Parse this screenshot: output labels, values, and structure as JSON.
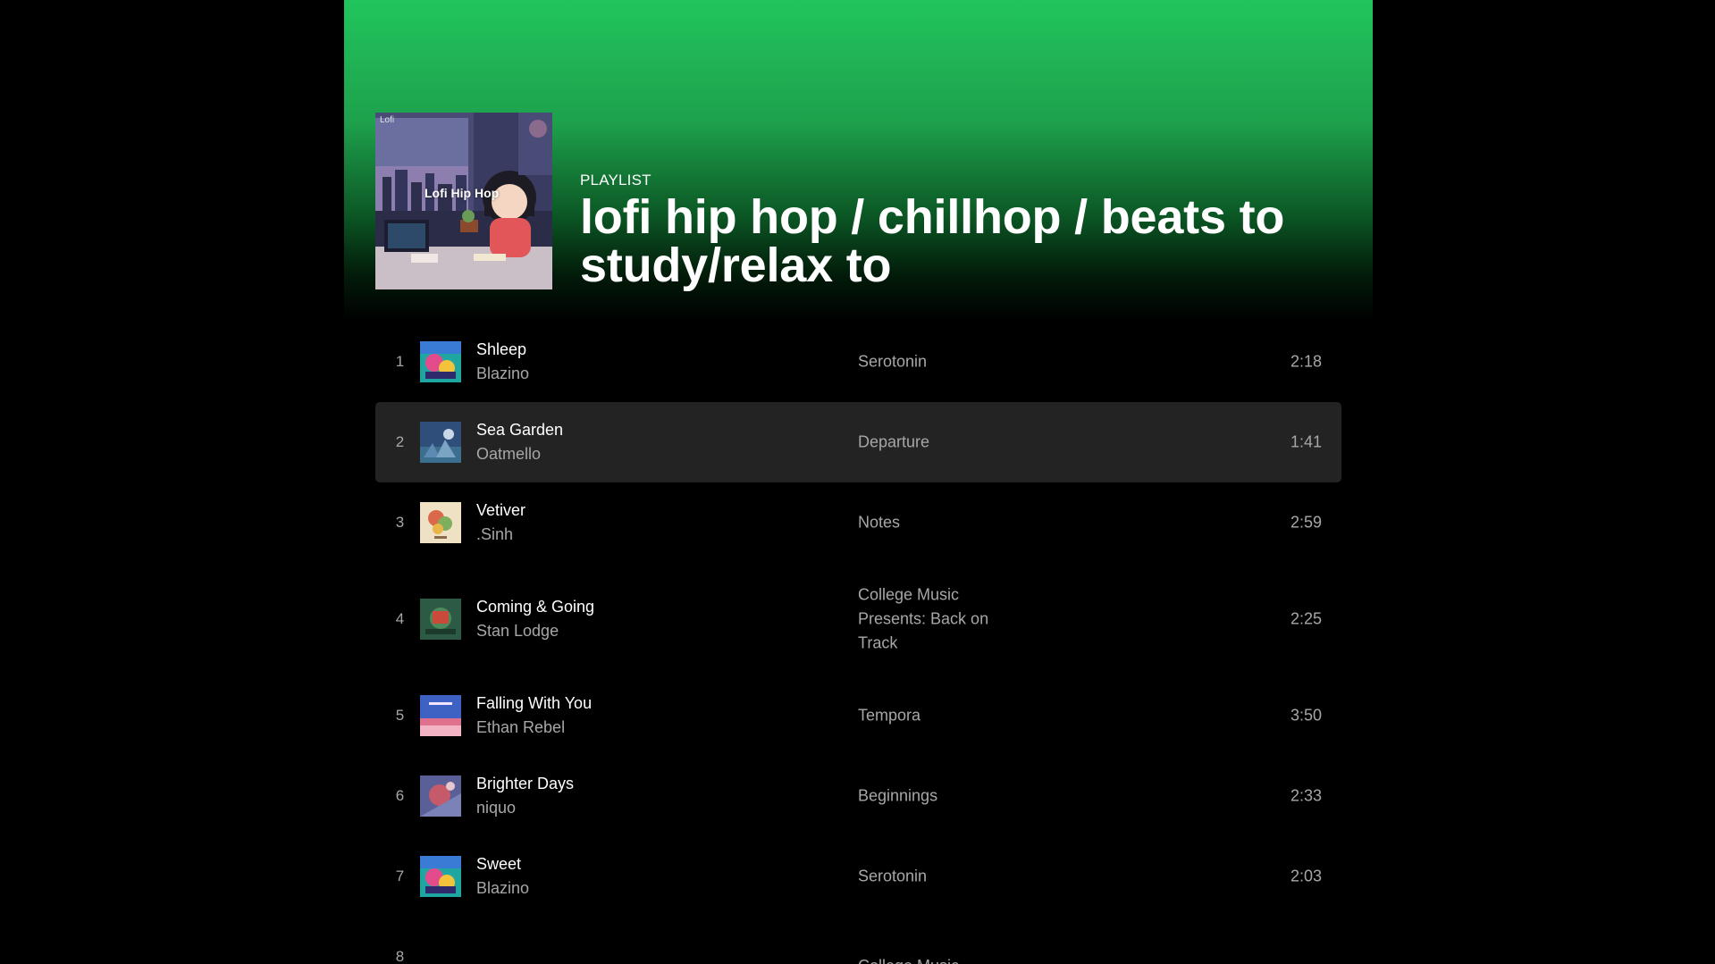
{
  "playlist": {
    "type_label": "PLAYLIST",
    "title": "lofi hip hop / chillhop / beats to study/relax to",
    "cover_text": "Lofi Hip Hop",
    "cover_mark": "Lofi"
  },
  "colors": {
    "hero_green": "#21c55d",
    "row_highlight": "#232323",
    "muted_text": "#a7a7a7"
  },
  "tracks": [
    {
      "num": "1",
      "title": "Shleep",
      "artist": "Blazino",
      "album": "Serotonin",
      "duration": "2:18"
    },
    {
      "num": "2",
      "title": "Sea Garden",
      "artist": "Oatmello",
      "album": "Departure",
      "duration": "1:41"
    },
    {
      "num": "3",
      "title": "Vetiver",
      "artist": ".Sinh",
      "album": "Notes",
      "duration": "2:59"
    },
    {
      "num": "4",
      "title": "Coming & Going",
      "artist": "Stan Lodge",
      "album": "College Music Presents: Back on Track",
      "duration": "2:25"
    },
    {
      "num": "5",
      "title": "Falling With You",
      "artist": "Ethan Rebel",
      "album": "Tempora",
      "duration": "3:50"
    },
    {
      "num": "6",
      "title": "Brighter Days",
      "artist": "niquo",
      "album": "Beginnings",
      "duration": "2:33"
    },
    {
      "num": "7",
      "title": "Sweet",
      "artist": "Blazino",
      "album": "Serotonin",
      "duration": "2:03"
    },
    {
      "num": "8",
      "title": "",
      "artist": "",
      "album": "College Music",
      "duration": ""
    }
  ]
}
